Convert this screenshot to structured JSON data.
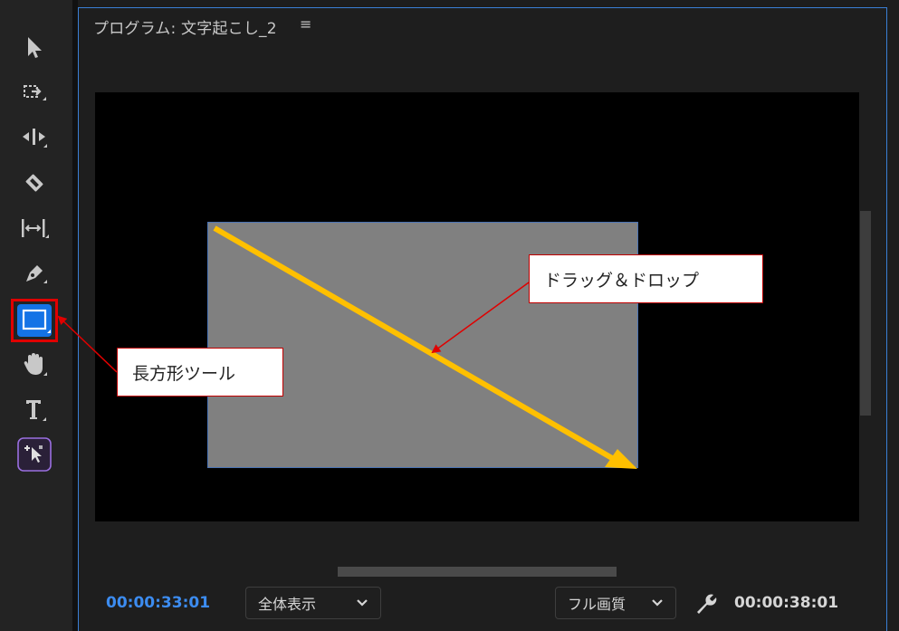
{
  "panel": {
    "title": "プログラム: 文字起こし_2",
    "menu_icon": "≡"
  },
  "toolbar": {
    "tools": [
      {
        "name": "selection-tool",
        "icon": "arrow-pointer-icon"
      },
      {
        "name": "track-select-tool",
        "icon": "track-select-forward-icon"
      },
      {
        "name": "ripple-edit-tool",
        "icon": "ripple-edit-icon"
      },
      {
        "name": "razor-tool",
        "icon": "razor-icon"
      },
      {
        "name": "slip-tool",
        "icon": "slip-icon"
      },
      {
        "name": "pen-tool",
        "icon": "pen-icon"
      },
      {
        "name": "rectangle-tool",
        "icon": "rectangle-icon",
        "active": true
      },
      {
        "name": "hand-tool",
        "icon": "hand-icon"
      },
      {
        "name": "type-tool",
        "icon": "type-icon"
      },
      {
        "name": "auto-reframe-tool",
        "icon": "auto-reframe-icon"
      }
    ]
  },
  "footer": {
    "current_timecode": "00:00:33:01",
    "zoom_select": "全体表示",
    "quality_select": "フル画質",
    "duration_timecode": "00:00:38:01"
  },
  "annotations": {
    "drag_drop": "ドラッグ＆ドロップ",
    "rectangle_tool": "長方形ツール"
  },
  "colors": {
    "accent_blue": "#3c8cf0",
    "panel_border": "#3a7fd5",
    "callout_border": "#c00000",
    "guide_arrow": "#ffc000",
    "shape_fill": "#808080"
  }
}
